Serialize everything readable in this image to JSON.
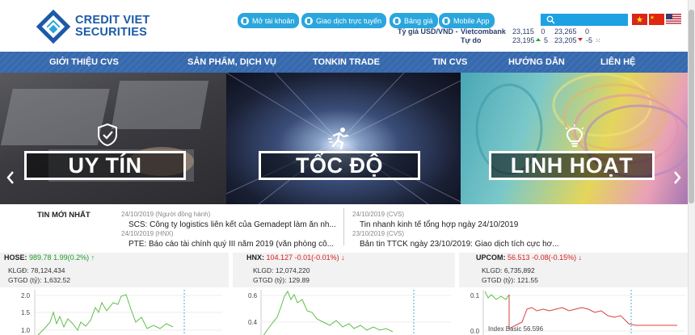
{
  "brand": {
    "line1": "CREDIT VIET",
    "line2": "SECURITIES",
    "color": "#1c5aa8"
  },
  "top_buttons": [
    {
      "label": "Mở tài khoản",
      "icon": "user-icon"
    },
    {
      "label": "Giao dịch trực tuyến",
      "icon": "user-icon"
    },
    {
      "label": "Bảng giá",
      "icon": "board-icon"
    },
    {
      "label": "Mobile App",
      "icon": "phone-icon"
    }
  ],
  "search": {
    "placeholder": ""
  },
  "languages": [
    "vi-flag",
    "zh-flag",
    "en-flag"
  ],
  "rates": {
    "label": "Tỷ giá USD/VND -",
    "row1": {
      "name": "Vietcombank",
      "buy": "23,115",
      "buy_change": "0",
      "sell": "23,265",
      "sell_change": "0"
    },
    "row2": {
      "name": "Tự do",
      "buy": "23,195",
      "buy_change": "5",
      "sell": "23,205",
      "sell_change": "-5"
    }
  },
  "nav": [
    "GIỚI THIỆU CVS",
    "SẢN PHẨM, DỊCH VỤ",
    "TONKIN TRADE",
    "TIN CVS",
    "HƯỚNG DẪN",
    "LIÊN HỆ"
  ],
  "banner": {
    "panels": [
      {
        "label": "UY TÍN",
        "icon": "shield-check-icon"
      },
      {
        "label": "TỐC ĐỘ",
        "icon": "runner-icon"
      },
      {
        "label": "LINH HOẠT",
        "icon": "lightbulb-icon"
      }
    ]
  },
  "news": {
    "title": "TIN MỚI NHẤT",
    "left": [
      {
        "date": "24/10/2019 (Người đồng hành)",
        "text": "SCS: Công ty logistics liên kết của Gemadept làm ăn nh..."
      },
      {
        "date": "24/10/2019 (HNX)",
        "text": "PTE: Báo cáo tài chính quý III năm 2019 (văn phòng cô..."
      }
    ],
    "right": [
      {
        "date": "24/10/2019 (CVS)",
        "text": "Tin nhanh kinh tế tổng hợp ngày 24/10/2019"
      },
      {
        "date": "23/10/2019 (CVS)",
        "text": "Bản tin TTCK ngày 23/10/2019: Giao dịch tích cực hơ..."
      }
    ]
  },
  "markets": [
    {
      "name": "HOSE:",
      "value": "989.78",
      "change": "1.99(0.2%)",
      "direction": "up",
      "klgd_label": "KLGĐ:",
      "klgd": "78,124,434",
      "gtgd_label": "GTGD (tỷ):",
      "gtgd": "1,632.52",
      "y_ticks": [
        "2.0",
        "1.5",
        "1.0"
      ]
    },
    {
      "name": "HNX:",
      "value": "104.127",
      "change": "-0.01(-0.01%)",
      "direction": "down",
      "klgd_label": "KLGD:",
      "klgd": "12,074,220",
      "gtgd_label": "GTGD (tỷ):",
      "gtgd": "129.89",
      "y_ticks": [
        "0.6",
        "0.4"
      ]
    },
    {
      "name": "UPCOM:",
      "value": "56.513",
      "change": "-0.08(-0.15%)",
      "direction": "down",
      "klgd_label": "KLGD:",
      "klgd": "6,735,892",
      "gtgd_label": "GTGD (tỷ):",
      "gtgd": "121.55",
      "y_ticks": [
        "0.1",
        "0.0"
      ],
      "annotation": "Index Basic 56.596"
    }
  ],
  "colors": {
    "nav": "#3669ae",
    "pill": "#2aa6dd",
    "up": "#1f9a2a",
    "down": "#d52020",
    "line_green": "#5ec04a",
    "line_red": "#d84040"
  }
}
